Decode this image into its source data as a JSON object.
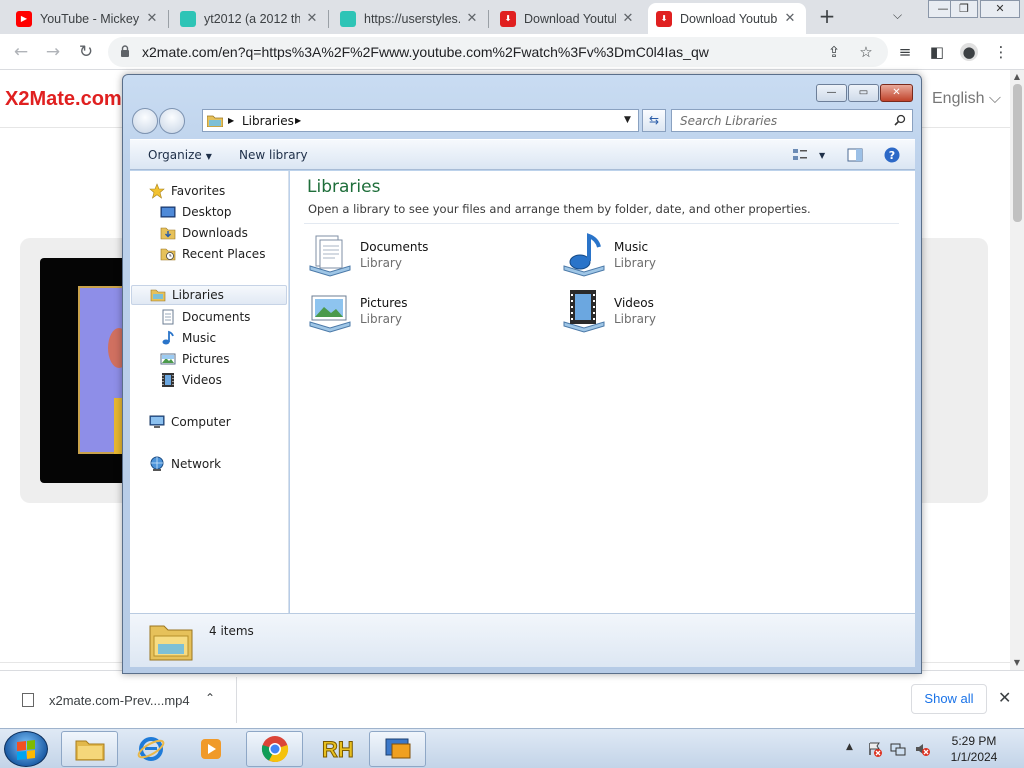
{
  "browser": {
    "tabs": [
      {
        "title": "YouTube - Mickey",
        "favicon": "youtube-icon",
        "color": "#ff0000",
        "fav_text": "You Tube"
      },
      {
        "title": "yt2012 (a 2012 th",
        "favicon": "userstyles-icon",
        "color": "#2ec4b6"
      },
      {
        "title": "https://userstyles.",
        "favicon": "userstyles-icon",
        "color": "#2ec4b6"
      },
      {
        "title": "Download Youtub",
        "favicon": "x2mate-icon",
        "color": "#e02020"
      },
      {
        "title": "Download Youtub",
        "favicon": "x2mate-icon",
        "color": "#e02020",
        "active": true
      }
    ],
    "url": "x2mate.com/en?q=https%3A%2F%2Fwww.youtube.com%2Fwatch%3Fv%3DmC0l4Ias_qw"
  },
  "page": {
    "logo": "X2Mate.com",
    "language": "English ⌵"
  },
  "download": {
    "filename": "x2mate.com-Prev....mp4",
    "show_all": "Show all"
  },
  "explorer": {
    "breadcrumb": "Libraries",
    "search_placeholder": "Search Libraries",
    "commands": {
      "organize": "Organize",
      "new_library": "New library"
    },
    "nav": {
      "favorites": "Favorites",
      "desktop": "Desktop",
      "downloads": "Downloads",
      "recent": "Recent Places",
      "libraries": "Libraries",
      "documents": "Documents",
      "music": "Music",
      "pictures": "Pictures",
      "videos": "Videos",
      "computer": "Computer",
      "network": "Network"
    },
    "heading": "Libraries",
    "description": "Open a library to see your files and arrange them by folder, date, and other properties.",
    "libraries": [
      {
        "name": "Documents",
        "type": "Library",
        "icon": "documents-library-icon"
      },
      {
        "name": "Music",
        "type": "Library",
        "icon": "music-library-icon"
      },
      {
        "name": "Pictures",
        "type": "Library",
        "icon": "pictures-library-icon"
      },
      {
        "name": "Videos",
        "type": "Library",
        "icon": "videos-library-icon"
      }
    ],
    "item_count": "4 items"
  },
  "taskbar": {
    "time": "5:29 PM",
    "date": "1/1/2024",
    "pinned": [
      "explorer-icon",
      "internet-explorer-icon",
      "media-player-icon",
      "chrome-icon",
      "rh-icon",
      "remote-desktop-icon"
    ]
  },
  "colors": {
    "accent_red": "#e02020",
    "heading_green": "#1e6e3a",
    "link_blue": "#1a73e8"
  }
}
